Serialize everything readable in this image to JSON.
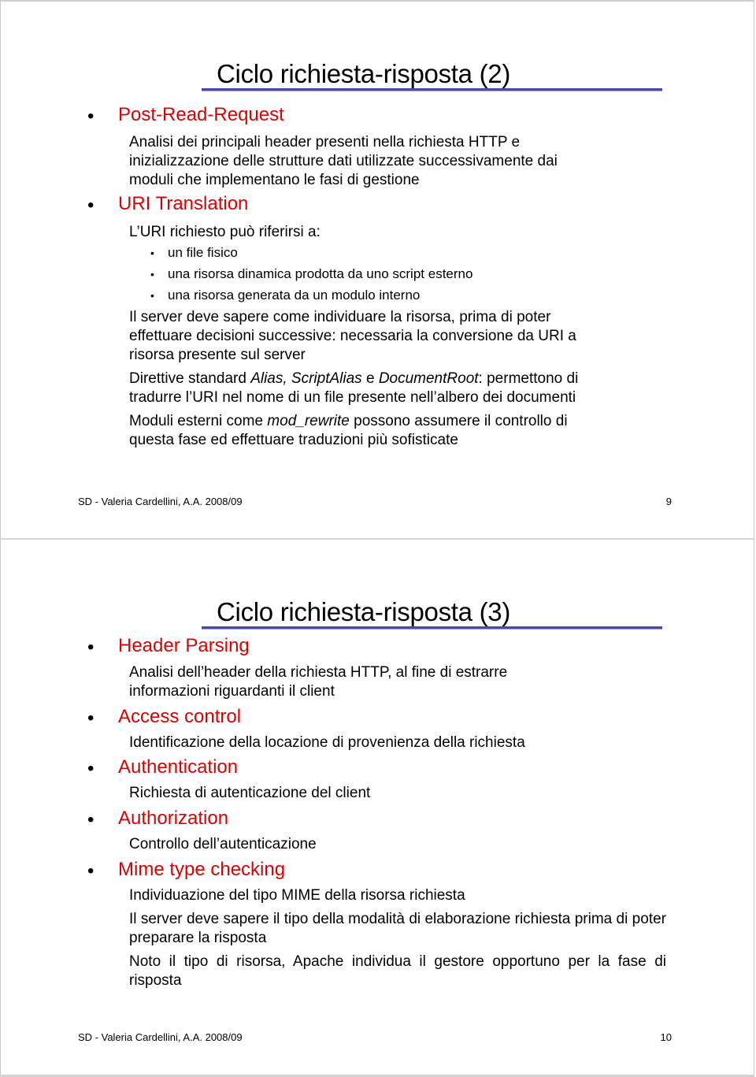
{
  "slides": [
    {
      "title": "Ciclo richiesta-risposta (2)",
      "sections": [
        {
          "heading": "Post-Read-Request",
          "lines": [
            "Analisi dei principali header presenti nella richiesta HTTP e",
            "inizializzazione delle strutture dati utilizzate successivamente dai",
            "moduli che implementano le fasi di gestione"
          ]
        },
        {
          "heading": "URI Translation",
          "intro": "L’URI richiesto può riferirsi a:",
          "subitems": [
            "un file fisico",
            "una risorsa dinamica prodotta da uno script esterno",
            "una risorsa generata da un modulo interno"
          ],
          "paragraphs": [
            {
              "lines": [
                "Il server deve sapere come individuare la risorsa, prima di poter",
                "effettuare decisioni successive: necessaria la conversione da URI a",
                "risorsa presente sul server"
              ]
            },
            {
              "segments": [
                {
                  "text": "Direttive standard ",
                  "italic": false
                },
                {
                  "text": "Alias, ScriptAlias",
                  "italic": true
                },
                {
                  "text": " e ",
                  "italic": false
                },
                {
                  "text": "DocumentRoot",
                  "italic": true
                },
                {
                  "text": ": permettono di",
                  "italic": false
                }
              ],
              "line2": "tradurre l’URI nel nome di un file presente nell’albero dei documenti"
            },
            {
              "segments": [
                {
                  "text": "Moduli esterni come ",
                  "italic": false
                },
                {
                  "text": "mod_rewrite",
                  "italic": true
                },
                {
                  "text": " possono assumere il controllo di",
                  "italic": false
                }
              ],
              "line2": "questa fase ed effettuare traduzioni più sofisticate"
            }
          ]
        }
      ],
      "footer": "SD - Valeria Cardellini, A.A. 2008/09",
      "page_number": "9"
    },
    {
      "title": "Ciclo richiesta-risposta (3)",
      "sections": [
        {
          "heading": "Header Parsing",
          "lines": [
            "Analisi dell’header della richiesta HTTP, al fine di estrarre",
            "informazioni riguardanti il client"
          ]
        },
        {
          "heading": "Access control",
          "lines": [
            "Identificazione della locazione di provenienza della richiesta"
          ]
        },
        {
          "heading": "Authentication",
          "lines": [
            "Richiesta di autenticazione del client"
          ]
        },
        {
          "heading": "Authorization",
          "lines": [
            "Controllo dell’autenticazione"
          ]
        },
        {
          "heading": "Mime type checking",
          "lines": [
            "Individuazione del tipo MIME della risorsa richiesta"
          ],
          "paragraphs": [
            "Il server deve sapere il tipo della modalità di elaborazione richiesta prima di poter preparare la risposta",
            "Noto il tipo di risorsa, Apache individua il gestore opportuno per la fase di risposta"
          ]
        }
      ],
      "footer": "SD - Valeria Cardellini, A.A. 2008/09",
      "page_number": "10"
    }
  ],
  "colors": {
    "heading": "#dd0000",
    "title_rule": "#4a4aa8",
    "text": "#000000"
  }
}
